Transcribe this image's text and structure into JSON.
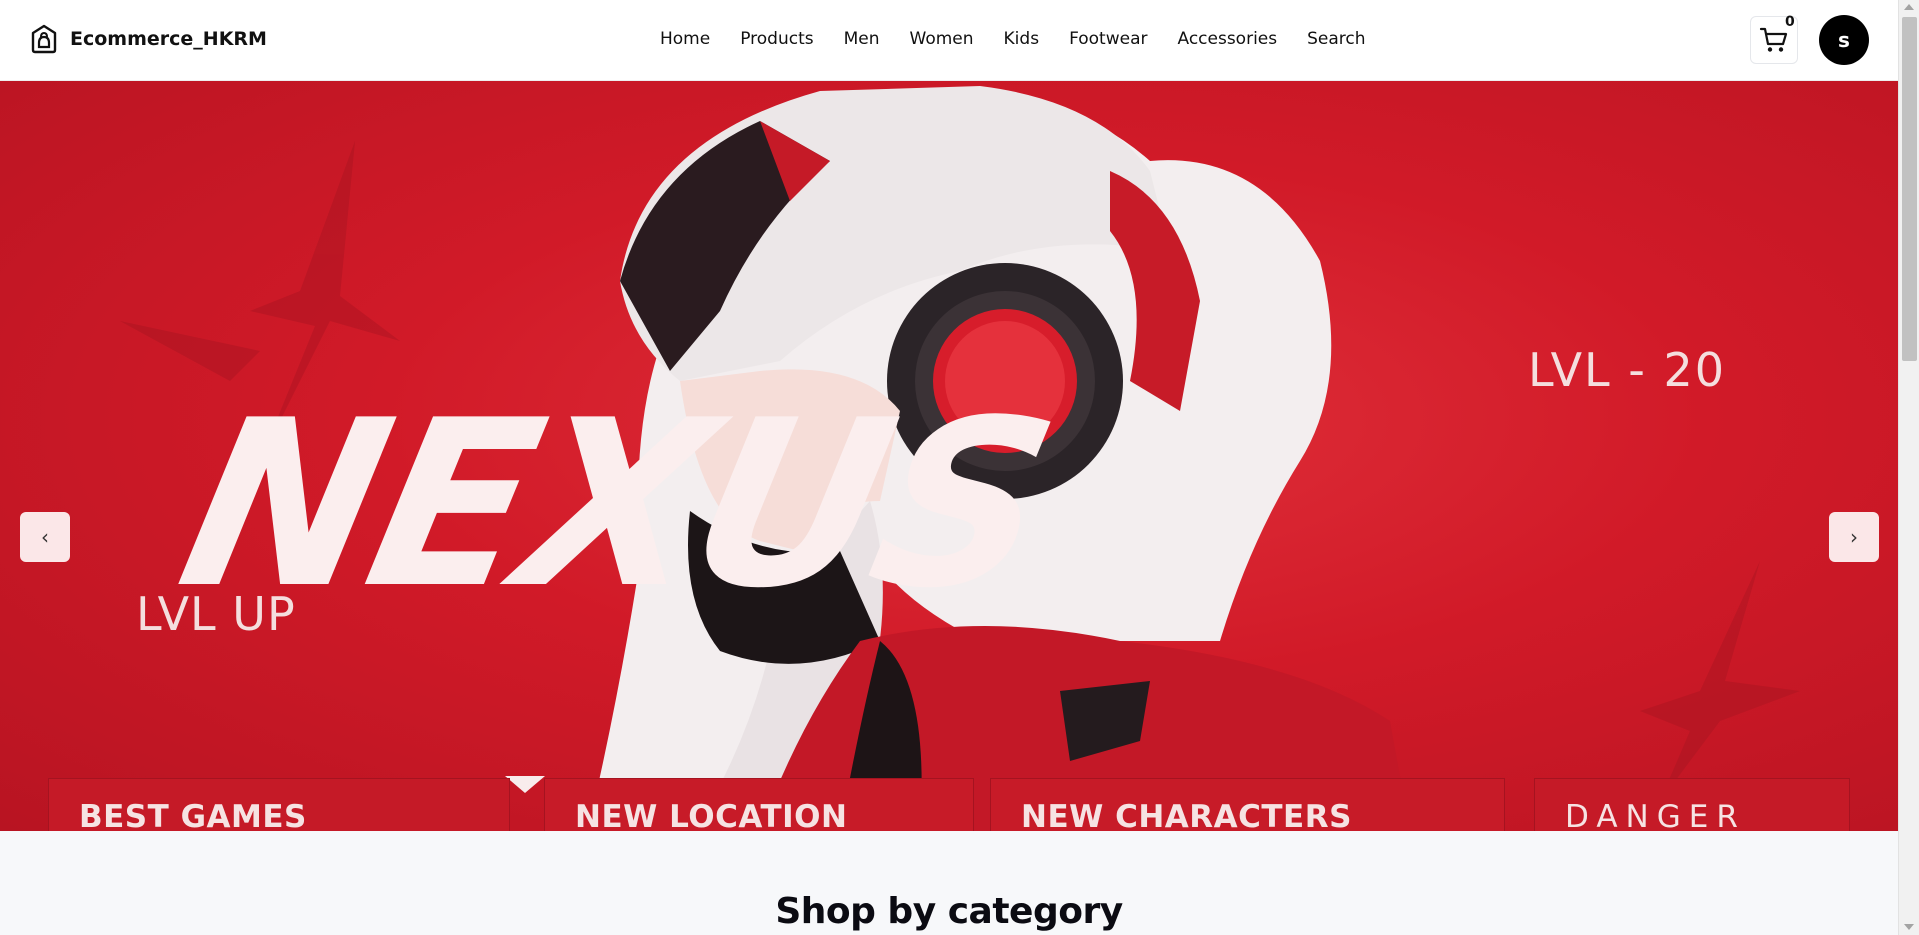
{
  "header": {
    "brand": "Ecommerce_HKRM",
    "nav": [
      "Home",
      "Products",
      "Men",
      "Women",
      "Kids",
      "Footwear",
      "Accessories",
      "Search"
    ],
    "cart_count": "0",
    "avatar_initial": "s"
  },
  "hero": {
    "big_text": "NEXUS",
    "level_text": "LVL - 20",
    "levelup_text": "LVL UP",
    "tabs": [
      "BEST GAMES",
      "NEW LOCATION",
      "NEW CHARACTERS",
      "DANGER"
    ],
    "prev_label": "‹",
    "next_label": "›",
    "accent_color": "#d11a28"
  },
  "section": {
    "title": "Shop by category"
  }
}
